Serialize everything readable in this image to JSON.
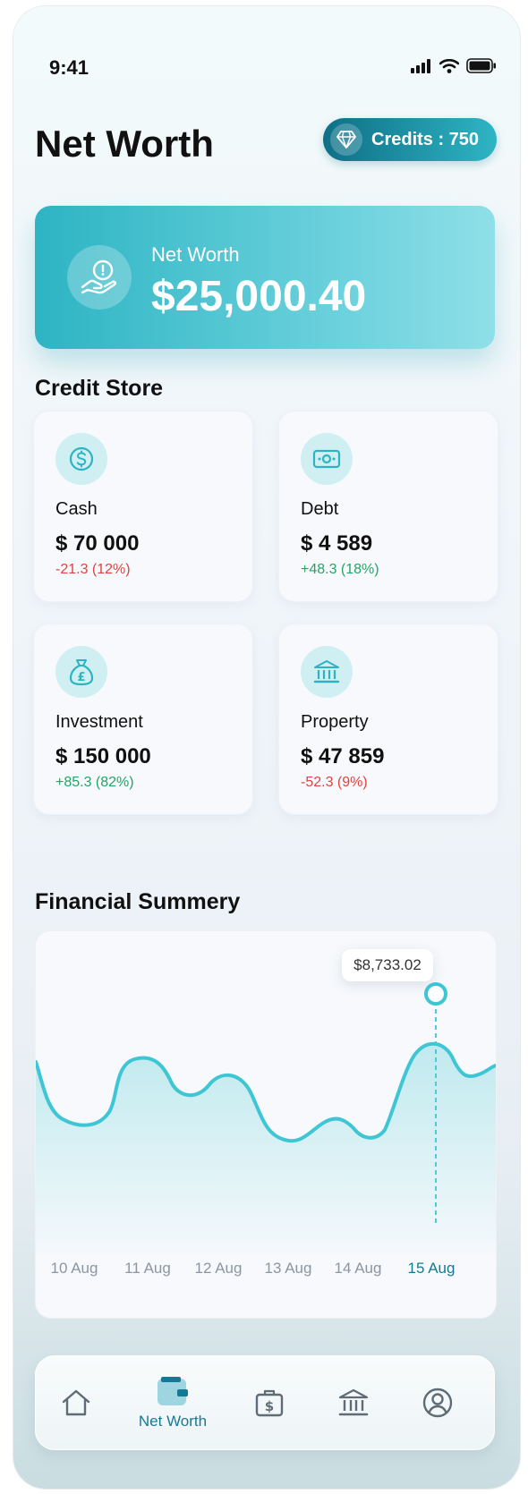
{
  "status_bar": {
    "time": "9:41"
  },
  "header": {
    "title": "Net Worth",
    "credits_label": "Credits : 750"
  },
  "networth_card": {
    "label": "Net Worth",
    "value": "$25,000.40"
  },
  "credit_store": {
    "title": "Credit Store",
    "items": [
      {
        "name": "Cash",
        "value": "$ 70 000",
        "change": "-21.3 (12%)",
        "trend": "negative",
        "icon": "dollar-coin-icon"
      },
      {
        "name": "Debt",
        "value": "$ 4 589",
        "change": "+48.3 (18%)",
        "trend": "positive",
        "icon": "banknote-icon"
      },
      {
        "name": "Investment",
        "value": "$ 150 000",
        "change": "+85.3 (82%)",
        "trend": "positive",
        "icon": "money-bag-icon"
      },
      {
        "name": "Property",
        "value": "$ 47 859",
        "change": "-52.3 (9%)",
        "trend": "negative",
        "icon": "bank-building-icon"
      }
    ]
  },
  "financial_summary": {
    "title": "Financial Summery",
    "tooltip": "$8,733.02"
  },
  "chart_data": {
    "type": "area",
    "x": [
      "10 Aug",
      "11 Aug",
      "12 Aug",
      "13 Aug",
      "14 Aug",
      "15 Aug"
    ],
    "highlighted_x": "15 Aug",
    "highlighted_value_label": "$8,733.02",
    "colors": {
      "line": "#3ec6d5",
      "fill": "#bde9ee",
      "active_label": "#137a96",
      "label": "#8d96a0"
    }
  },
  "bottom_nav": {
    "items": [
      {
        "icon": "home-icon",
        "label": ""
      },
      {
        "icon": "wallet-icon",
        "label": "Net Worth",
        "active": true
      },
      {
        "icon": "money-briefcase-icon",
        "label": ""
      },
      {
        "icon": "bank-icon",
        "label": ""
      },
      {
        "icon": "profile-icon",
        "label": ""
      }
    ]
  },
  "colors": {
    "accent": "#2db4c3",
    "accent_dark": "#137a96",
    "positive": "#22a565",
    "negative": "#e0433f"
  }
}
